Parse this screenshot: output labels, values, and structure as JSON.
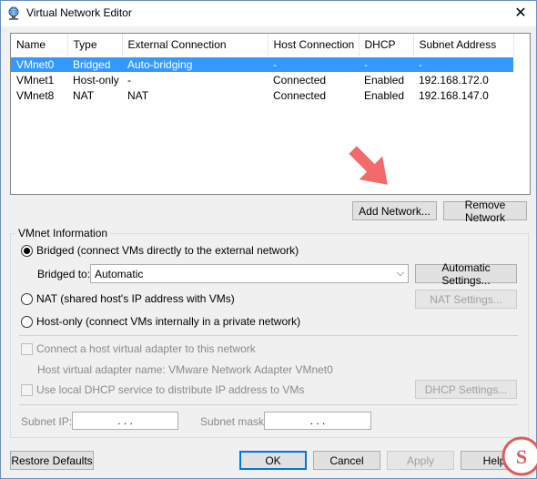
{
  "window": {
    "title": "Virtual Network Editor"
  },
  "table": {
    "headers": [
      "Name",
      "Type",
      "External Connection",
      "Host Connection",
      "DHCP",
      "Subnet Address"
    ],
    "rows": [
      [
        "VMnet0",
        "Bridged",
        "Auto-bridging",
        "-",
        "-",
        "-"
      ],
      [
        "VMnet1",
        "Host-only",
        "-",
        "Connected",
        "Enabled",
        "192.168.172.0"
      ],
      [
        "VMnet8",
        "NAT",
        "NAT",
        "Connected",
        "Enabled",
        "192.168.147.0"
      ]
    ]
  },
  "buttons": {
    "add_network": "Add Network...",
    "remove_network": "Remove Network",
    "automatic_settings": "Automatic Settings...",
    "nat_settings": "NAT Settings...",
    "dhcp_settings": "DHCP Settings...",
    "restore_defaults": "Restore Defaults",
    "ok": "OK",
    "cancel": "Cancel",
    "apply": "Apply",
    "help": "Help"
  },
  "vmnet_info": {
    "group_label": "VMnet Information",
    "bridged_label": "Bridged (connect VMs directly to the external network)",
    "bridged_to_label": "Bridged to:",
    "bridged_to_value": "Automatic",
    "nat_label": "NAT (shared host's IP address with VMs)",
    "hostonly_label": "Host-only (connect VMs internally in a private network)",
    "connect_adapter_label": "Connect a host virtual adapter to this network",
    "adapter_name_label": "Host virtual adapter name: VMware Network Adapter VMnet0",
    "dhcp_label": "Use local DHCP service to distribute IP address to VMs",
    "subnet_ip_label": "Subnet IP:",
    "subnet_mask_label": "Subnet mask:",
    "ip_dots": ". . .",
    "selected_mode": "bridged"
  },
  "colors": {
    "selection": "#3399ff",
    "arrow": "#f26a6a"
  },
  "icons": {
    "title": "network-globe-icon",
    "close": "close-icon",
    "watermark": "site-logo-icon"
  }
}
